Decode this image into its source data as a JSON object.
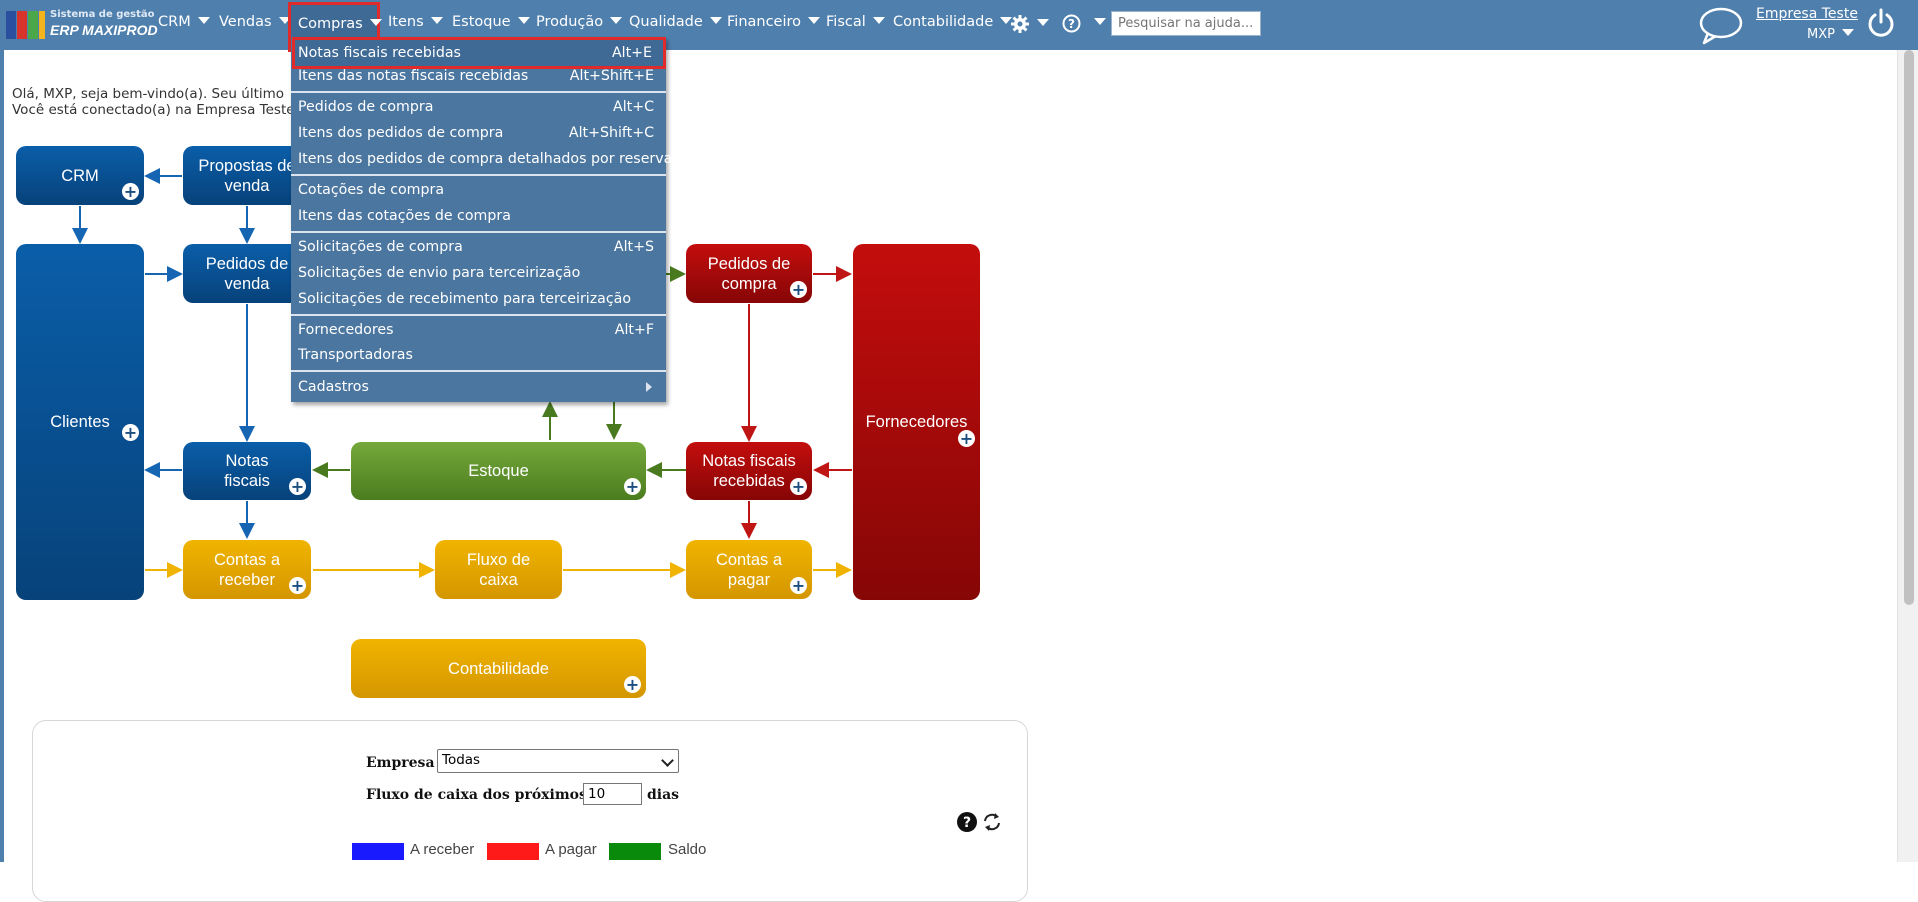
{
  "app": {
    "logo_line1": "Sistema de gestão",
    "logo_line2": "ERP MAXIPROD"
  },
  "nav": {
    "items": [
      {
        "label": "CRM"
      },
      {
        "label": "Vendas"
      },
      {
        "label": "Compras"
      },
      {
        "label": "Itens"
      },
      {
        "label": "Estoque"
      },
      {
        "label": "Produção"
      },
      {
        "label": "Qualidade"
      },
      {
        "label": "Financeiro"
      },
      {
        "label": "Fiscal"
      },
      {
        "label": "Contabilidade"
      }
    ],
    "search_placeholder": "Pesquisar na ajuda...",
    "company": "Empresa Teste",
    "user": "MXP",
    "icons": [
      "gear-icon",
      "help-icon",
      "chat-bubble-icon",
      "power-icon"
    ]
  },
  "welcome": {
    "line1": "Olá, MXP, seja bem-vindo(a). Seu último",
    "line2": "Você está conectado(a) na Empresa Teste"
  },
  "menu": {
    "items": [
      {
        "label": "Notas fiscais recebidas",
        "shortcut": "Alt+E"
      },
      {
        "label": "Itens das notas fiscais recebidas",
        "shortcut": "Alt+Shift+E"
      },
      {
        "label": "Pedidos de compra",
        "shortcut": "Alt+C"
      },
      {
        "label": "Itens dos pedidos de compra",
        "shortcut": "Alt+Shift+C"
      },
      {
        "label": "Itens dos pedidos de compra detalhados por reserva",
        "shortcut": ""
      },
      {
        "label": "Cotações de compra",
        "shortcut": ""
      },
      {
        "label": "Itens das cotações de compra",
        "shortcut": ""
      },
      {
        "label": "Solicitações de compra",
        "shortcut": "Alt+S"
      },
      {
        "label": "Solicitações de envio para terceirização",
        "shortcut": ""
      },
      {
        "label": "Solicitações de recebimento para terceirização",
        "shortcut": ""
      },
      {
        "label": "Fornecedores",
        "shortcut": "Alt+F"
      },
      {
        "label": "Transportadoras",
        "shortcut": ""
      },
      {
        "label": "Cadastros",
        "shortcut": ""
      }
    ]
  },
  "flow": {
    "crm": "CRM",
    "propostas_l1": "Propostas de",
    "propostas_l2": "venda",
    "pedidos_venda_l1": "Pedidos de",
    "pedidos_venda_l2": "venda",
    "clientes": "Clientes",
    "notas_l1": "Notas",
    "notas_l2": "fiscais",
    "estoque": "Estoque",
    "pedidos_compra_l1": "Pedidos de",
    "pedidos_compra_l2": "compra",
    "nf_recebidas_l1": "Notas fiscais",
    "nf_recebidas_l2": "recebidas",
    "fornecedores": "Fornecedores",
    "contas_receber_l1": "Contas a",
    "contas_receber_l2": "receber",
    "fluxo_l1": "Fluxo de",
    "fluxo_l2": "caixa",
    "contas_pagar_l1": "Contas a",
    "contas_pagar_l2": "pagar",
    "contabilidade": "Contabilidade"
  },
  "panel": {
    "empresa_label": "Empresa",
    "empresa_value": "Todas",
    "fluxo_label": "Fluxo de caixa dos próximos",
    "dias_value": "10",
    "dias_label": "dias",
    "legend": [
      {
        "label": "A receber",
        "color": "#1a1aff"
      },
      {
        "label": "A pagar",
        "color": "#ff1a1a"
      },
      {
        "label": "Saldo",
        "color": "#0a8a0a"
      }
    ]
  },
  "colors": {
    "topbar": "#4f7fad",
    "highlight": "#e12b2b",
    "blue_box": "#0a5ea9",
    "red_box": "#b00a0a",
    "green_box": "#6a9e35",
    "yellow_box": "#e7a900"
  }
}
